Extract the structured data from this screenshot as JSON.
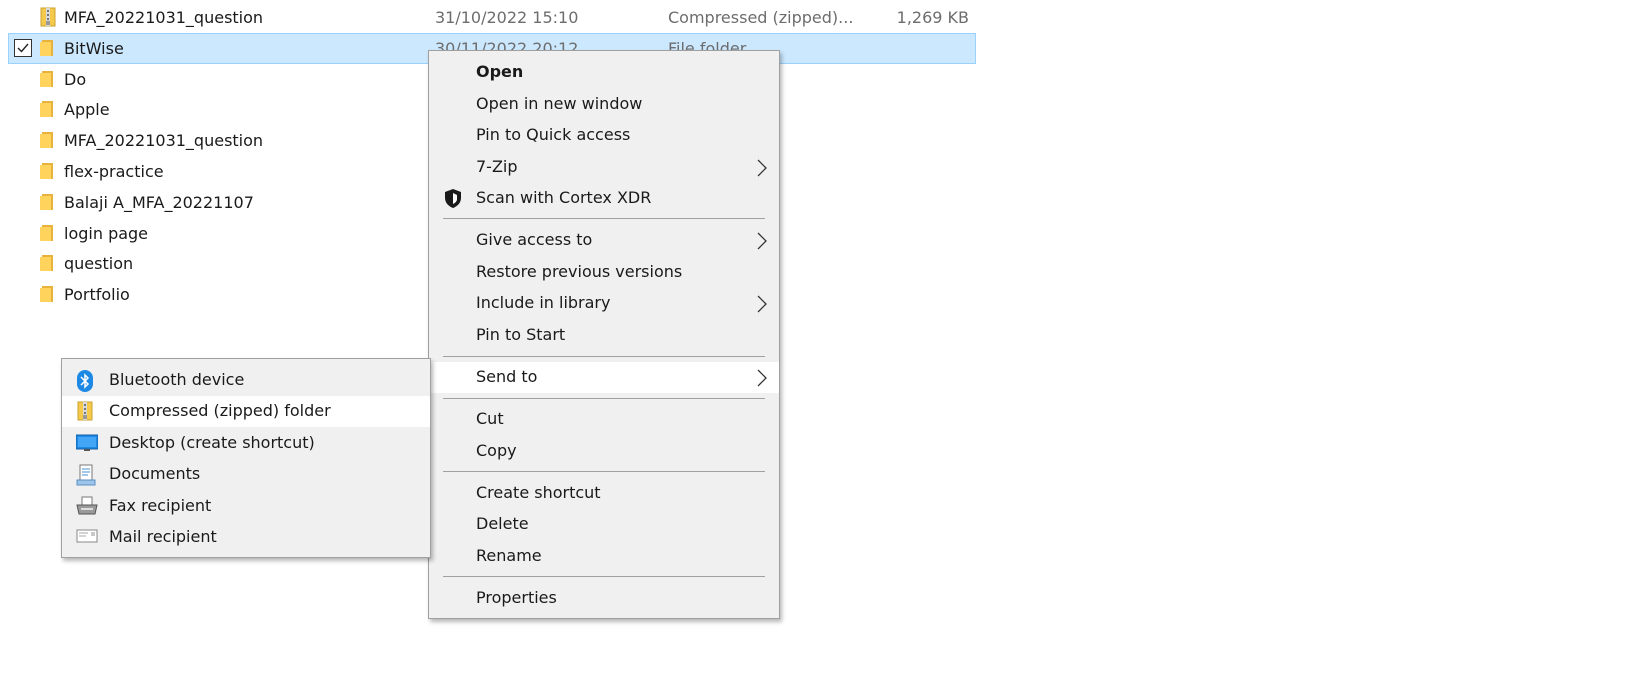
{
  "files": [
    {
      "name": "MFA_20221031_question",
      "date": "31/10/2022 15:10",
      "type": "Compressed (zipped)...",
      "size": "1,269 KB",
      "icon": "zip-folder-icon",
      "selected": false
    },
    {
      "name": "BitWise",
      "date": "30/11/2022 20:12",
      "type": "File folder",
      "size": "",
      "icon": "folder-icon",
      "selected": true
    },
    {
      "name": "Do",
      "date": "",
      "type": "",
      "size": "",
      "icon": "folder-icon",
      "selected": false
    },
    {
      "name": "Apple",
      "date": "",
      "type": "",
      "size": "",
      "icon": "folder-icon",
      "selected": false
    },
    {
      "name": "MFA_20221031_question",
      "date": "",
      "type": "",
      "size": "",
      "icon": "folder-icon",
      "selected": false
    },
    {
      "name": "flex-practice",
      "date": "",
      "type": "",
      "size": "",
      "icon": "folder-icon",
      "selected": false
    },
    {
      "name": "Balaji A_MFA_20221107",
      "date": "",
      "type": "",
      "size": "",
      "icon": "folder-icon",
      "selected": false
    },
    {
      "name": "login page",
      "date": "",
      "type": "",
      "size": "",
      "icon": "folder-icon",
      "selected": false
    },
    {
      "name": "question",
      "date": "",
      "type": "",
      "size": "",
      "icon": "folder-icon",
      "selected": false
    },
    {
      "name": "Portfolio",
      "date": "",
      "type": "",
      "size": "",
      "icon": "folder-icon",
      "selected": false
    }
  ],
  "context_menu": {
    "items": [
      {
        "label": "Open",
        "bold": true
      },
      {
        "label": "Open in new window"
      },
      {
        "label": "Pin to Quick access"
      },
      {
        "label": "7-Zip",
        "submenu": true
      },
      {
        "label": "Scan with Cortex XDR",
        "icon": "cortex-shield-icon"
      },
      {
        "label": "Give access to",
        "submenu": true
      },
      {
        "label": "Restore previous versions"
      },
      {
        "label": "Include in library",
        "submenu": true
      },
      {
        "label": "Pin to Start"
      },
      {
        "label": "Send to",
        "submenu": true,
        "highlighted": true
      },
      {
        "label": "Cut"
      },
      {
        "label": "Copy"
      },
      {
        "label": "Create shortcut"
      },
      {
        "label": "Delete"
      },
      {
        "label": "Rename"
      },
      {
        "label": "Properties"
      }
    ]
  },
  "send_to_menu": {
    "items": [
      {
        "label": "Bluetooth device",
        "icon": "bluetooth-icon"
      },
      {
        "label": "Compressed (zipped) folder",
        "icon": "zip-folder-icon",
        "highlighted": true
      },
      {
        "label": "Desktop (create shortcut)",
        "icon": "desktop-icon"
      },
      {
        "label": "Documents",
        "icon": "documents-icon"
      },
      {
        "label": "Fax recipient",
        "icon": "fax-icon"
      },
      {
        "label": "Mail recipient",
        "icon": "mail-icon"
      }
    ]
  },
  "colors": {
    "selection_bg": "#cce8ff",
    "selection_border": "#99d1ff",
    "menu_bg": "#f0f0f0",
    "menu_hover": "#ffffff",
    "folder_yellow": "#ffd35c"
  }
}
